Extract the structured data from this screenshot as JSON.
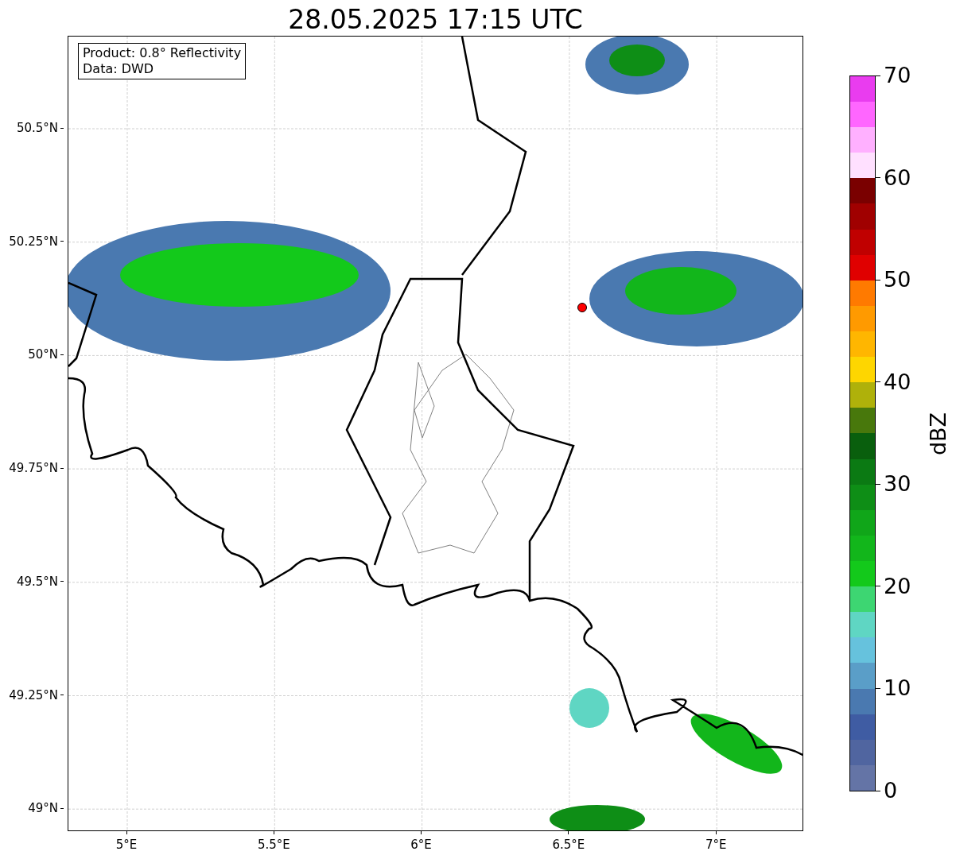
{
  "title": "28.05.2025 17:15 UTC",
  "info_box": [
    "Product: 0.8° Reflectivity",
    "Data: DWD"
  ],
  "map": {
    "yticks": [
      "50.5°N",
      "50.25°N",
      "50°N",
      "49.75°N",
      "49.5°N",
      "49.25°N",
      "49°N"
    ],
    "xticks": [
      "5°E",
      "5.5°E",
      "6°E",
      "6.5°E",
      "7°E"
    ]
  },
  "colorbar": {
    "label": "dBZ",
    "ticks": [
      "70",
      "60",
      "50",
      "40",
      "30",
      "20",
      "10",
      "0"
    ],
    "bands": [
      {
        "color": "#6474a6"
      },
      {
        "color": "#5065a0"
      },
      {
        "color": "#3f5ca3"
      },
      {
        "color": "#4a79b0"
      },
      {
        "color": "#5a9ec8"
      },
      {
        "color": "#66c2dd"
      },
      {
        "color": "#5fd6c3"
      },
      {
        "color": "#3dd672"
      },
      {
        "color": "#13c91b"
      },
      {
        "color": "#12b61b"
      },
      {
        "color": "#10a619"
      },
      {
        "color": "#0e8e16"
      },
      {
        "color": "#0b7a13"
      },
      {
        "color": "#095f0d"
      },
      {
        "color": "#48780c"
      },
      {
        "color": "#afb10a"
      },
      {
        "color": "#fed600"
      },
      {
        "color": "#ffb600"
      },
      {
        "color": "#ff9a00"
      },
      {
        "color": "#ff7a00"
      },
      {
        "color": "#e00000"
      },
      {
        "color": "#c00000"
      },
      {
        "color": "#a00000"
      },
      {
        "color": "#7a0000"
      },
      {
        "color": "#ffe0ff"
      },
      {
        "color": "#ffb0ff"
      },
      {
        "color": "#ff66ff"
      },
      {
        "color": "#e93cef"
      }
    ]
  }
}
